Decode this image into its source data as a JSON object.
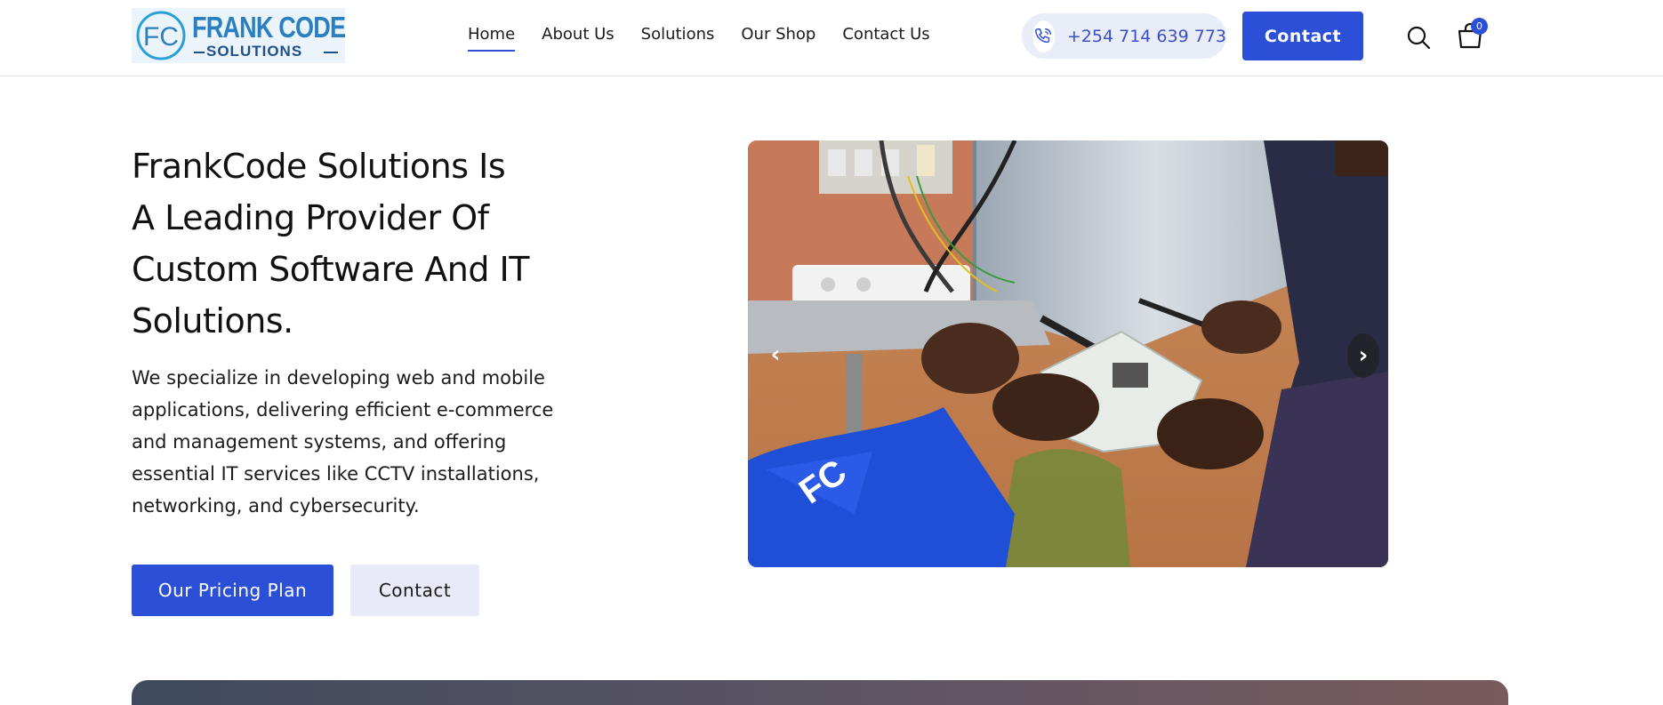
{
  "header": {
    "logo": {
      "title": "FRANK CODE",
      "subtitle": "SOLUTIONS",
      "mark": "FC"
    },
    "nav": [
      {
        "label": "Home",
        "active": true
      },
      {
        "label": "About Us",
        "active": false
      },
      {
        "label": "Solutions",
        "active": false
      },
      {
        "label": "Our Shop",
        "active": false
      },
      {
        "label": "Contact Us",
        "active": false
      }
    ],
    "phone": {
      "number": "+254 714 639 773",
      "icon": "phone-icon"
    },
    "contact_button": "Contact",
    "search_icon": "search-icon",
    "cart": {
      "icon": "shopping-bag-icon",
      "count": "0"
    }
  },
  "hero": {
    "title_lines": [
      "FrankCode Solutions Is",
      "A Leading Provider Of",
      "Custom Software And IT",
      "Solutions."
    ],
    "description": "We specialize in developing web and mobile applications, delivering efficient e-commerce and management systems, and offering essential IT services like CCTV installations, networking, and cybersecurity.",
    "primary_button": "Our Pricing Plan",
    "secondary_button": "Contact"
  },
  "slider": {
    "prev_label": "‹",
    "next_label": "›"
  },
  "colors": {
    "accent": "#2b4fd6",
    "pill_bg": "#e9edf8",
    "secondary_btn_bg": "#e8ebf7"
  }
}
